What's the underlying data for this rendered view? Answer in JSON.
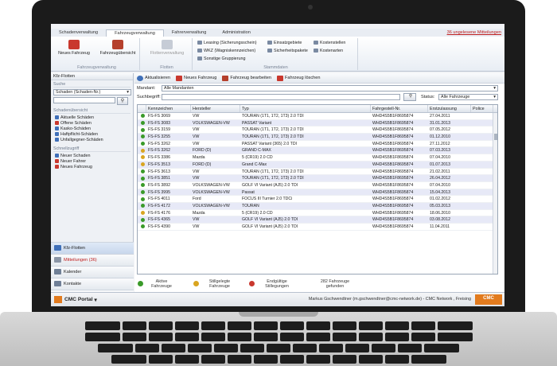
{
  "ribbon": {
    "tabs": [
      {
        "label": "Schadenverwaltung",
        "active": false
      },
      {
        "label": "Fahrzeugverwaltung",
        "active": true
      },
      {
        "label": "Fahrerverwaltung",
        "active": false
      },
      {
        "label": "Administration",
        "active": false
      }
    ],
    "unread_link": "36 ungelesene Mitteilungen",
    "groups": {
      "fahrzeugverwaltung": {
        "title": "Fahrzeugverwaltung",
        "new_vehicle": "Neues Fahrzeug",
        "overview": "Fahrzeugübersicht"
      },
      "flotten": {
        "title": "Flotten",
        "fleet_mgmt": "Flottenverwaltung"
      },
      "stammdaten": {
        "title": "Stammdaten",
        "leasing": "Leasing (Sicherungsschein)",
        "wkz": "WKZ (Wagniskennzeichen)",
        "sonstige": "Sonstige Gruppierung",
        "einsatzgebiete": "Einsatzgebiete",
        "sicherheitspakete": "Sicherheitspakete",
        "kostenstellen": "Kostenstellen",
        "kostenarten": "Kostenarten"
      }
    }
  },
  "sidebar": {
    "title": "Kfz-Flotten",
    "search_label": "Suche",
    "search_select": "Schaden (Schaden-Nr.)",
    "overview_label": "Schadenübersicht",
    "overview_items": [
      "Aktuelle Schäden",
      "Offene Schäden",
      "Kasko-Schäden",
      "Haftpflicht-Schäden",
      "Unfallgegner-Schäden"
    ],
    "quick_label": "Schnellzugriff",
    "quick_items": [
      "Neuer Schaden",
      "Neuer Fahrer",
      "Neues Fahrzeug"
    ],
    "nav": [
      "Kfz-Flotten",
      "Mitteilungen (36)",
      "Kalender",
      "Kontakte",
      "Auswertungen"
    ]
  },
  "toolbar": {
    "refresh": "Aktualisieren",
    "new_vehicle": "Neues Fahrzeug",
    "edit_vehicle": "Fahrzeug bearbeiten",
    "delete_vehicle": "Fahrzeug löschen"
  },
  "filters": {
    "mandant_label": "Mandant:",
    "mandant_value": "Alle Mandanten",
    "search_label": "Suchbegriff:",
    "status_label": "Status:",
    "status_value": "Alle Fahrzeuge"
  },
  "grid": {
    "columns": [
      "Kennzeichen",
      "Hersteller",
      "Typ",
      "Fahrgestell-Nr.",
      "Erstzulassung",
      "Police"
    ],
    "rows": [
      {
        "kz": "FS-FS 3069",
        "hersteller": "VW",
        "typ": "TOURAN (1T1, 1T2, 1T3) 2.0 TDI",
        "fin": "WHD4S5B1F8695874",
        "ez": "27.04.2011",
        "status": "green"
      },
      {
        "kz": "FS-FS 3083",
        "hersteller": "VOLKSWAGEN-VW",
        "typ": "PASSAT Variant",
        "fin": "WHD4S5B1F8695874",
        "ez": "31.01.2013",
        "status": "green"
      },
      {
        "kz": "FS-FS 3159",
        "hersteller": "VW",
        "typ": "TOURAN (1T1, 1T2, 1T3) 2.0 TDI",
        "fin": "WHD4S5B1F8695874",
        "ez": "07.05.2012",
        "status": "green"
      },
      {
        "kz": "FS-FS 3255",
        "hersteller": "VW",
        "typ": "TOURAN (1T1, 1T2, 1T3) 2.0 TDI",
        "fin": "WHD4S5B1F8695874",
        "ez": "01.12.2010",
        "status": "green"
      },
      {
        "kz": "FS-FS 3262",
        "hersteller": "VW",
        "typ": "PASSAT Variant (365) 2.0 TDI",
        "fin": "WHD4S5B1F8695874",
        "ez": "27.11.2012",
        "status": "green"
      },
      {
        "kz": "FS-FS 3262",
        "hersteller": "FORD (D)",
        "typ": "GRAND C-MAX",
        "fin": "WHD4S5B1F8695874",
        "ez": "07.03.2013",
        "status": "yellow"
      },
      {
        "kz": "FS-FS 3386",
        "hersteller": "Mazda",
        "typ": "5 (CR19) 2.0 CD",
        "fin": "WHD4S5B1F8695874",
        "ez": "07.04.2010",
        "status": "yellow"
      },
      {
        "kz": "FS-FS 3513",
        "hersteller": "FORD (D)",
        "typ": "Grand C-Max",
        "fin": "WHD4S5B1F8695874",
        "ez": "01.07.2013",
        "status": "yellow"
      },
      {
        "kz": "FS-FS 3613",
        "hersteller": "VW",
        "typ": "TOURAN (1T1, 1T2, 1T3) 2.0 TDI",
        "fin": "WHD4S5B1F8695874",
        "ez": "21.02.2011",
        "status": "green"
      },
      {
        "kz": "FS-FS 3851",
        "hersteller": "VW",
        "typ": "TOURAN (1T1, 1T2, 1T3) 2.0 TDI",
        "fin": "WHD4S5B1F8695874",
        "ez": "26.04.2012",
        "status": "green"
      },
      {
        "kz": "FS-FS 3892",
        "hersteller": "VOLKSWAGEN-VW",
        "typ": "GOLF VI Variant (AJ5) 2.0 TDI",
        "fin": "WHD4S5B1F8695874",
        "ez": "07.04.2010",
        "status": "green"
      },
      {
        "kz": "FS-FS 3995",
        "hersteller": "VOLKSWAGEN-VW",
        "typ": "Passat",
        "fin": "WHD4S5B1F8695874",
        "ez": "15.04.2013",
        "status": "green"
      },
      {
        "kz": "FS-FS 4011",
        "hersteller": "Ford",
        "typ": "FOCUS III Turnier 2.0 TDCi",
        "fin": "WHD4S5B1F8695874",
        "ez": "01.02.2012",
        "status": "green"
      },
      {
        "kz": "FS-FS 4172",
        "hersteller": "VOLKSWAGEN-VW",
        "typ": "TOURAN",
        "fin": "WHD4S5B1F8695874",
        "ez": "05.03.2013",
        "status": "green"
      },
      {
        "kz": "FS-FS 4176",
        "hersteller": "Mazda",
        "typ": "5 (CR19) 2.0 CD",
        "fin": "WHD4S5B1F8695874",
        "ez": "18.06.2010",
        "status": "yellow"
      },
      {
        "kz": "FS-FS 4365",
        "hersteller": "VW",
        "typ": "GOLF VI Variant (AJ5) 2.0 TDI",
        "fin": "WHD4S5B1F8695874",
        "ez": "03.08.2012",
        "status": "green"
      },
      {
        "kz": "FS-FS 4390",
        "hersteller": "VW",
        "typ": "GOLF VI Variant (AJ5) 2.0 TDI",
        "fin": "WHD4S5B1F8695874",
        "ez": "11.04.2011",
        "status": "green"
      }
    ]
  },
  "footer_stats": {
    "active": "Aktive Fahrzeuge",
    "stillgelegt": "Stillgelegte Fahrzeuge",
    "endgueltig": "Endgültige Stillegungen",
    "found": "282 Fahrzeuge gefunden"
  },
  "statusbar": {
    "portal": "CMC Portal",
    "user": "Markus Gschwendtner (m.gschwendtner@cmc-network.de) - CMC Network , Freising",
    "logo": "CMC"
  },
  "colors": {
    "accent": "#e27b1e",
    "status_green": "#3a9a2a",
    "status_yellow": "#d9a520",
    "row_alt": "#e7e9f7"
  }
}
